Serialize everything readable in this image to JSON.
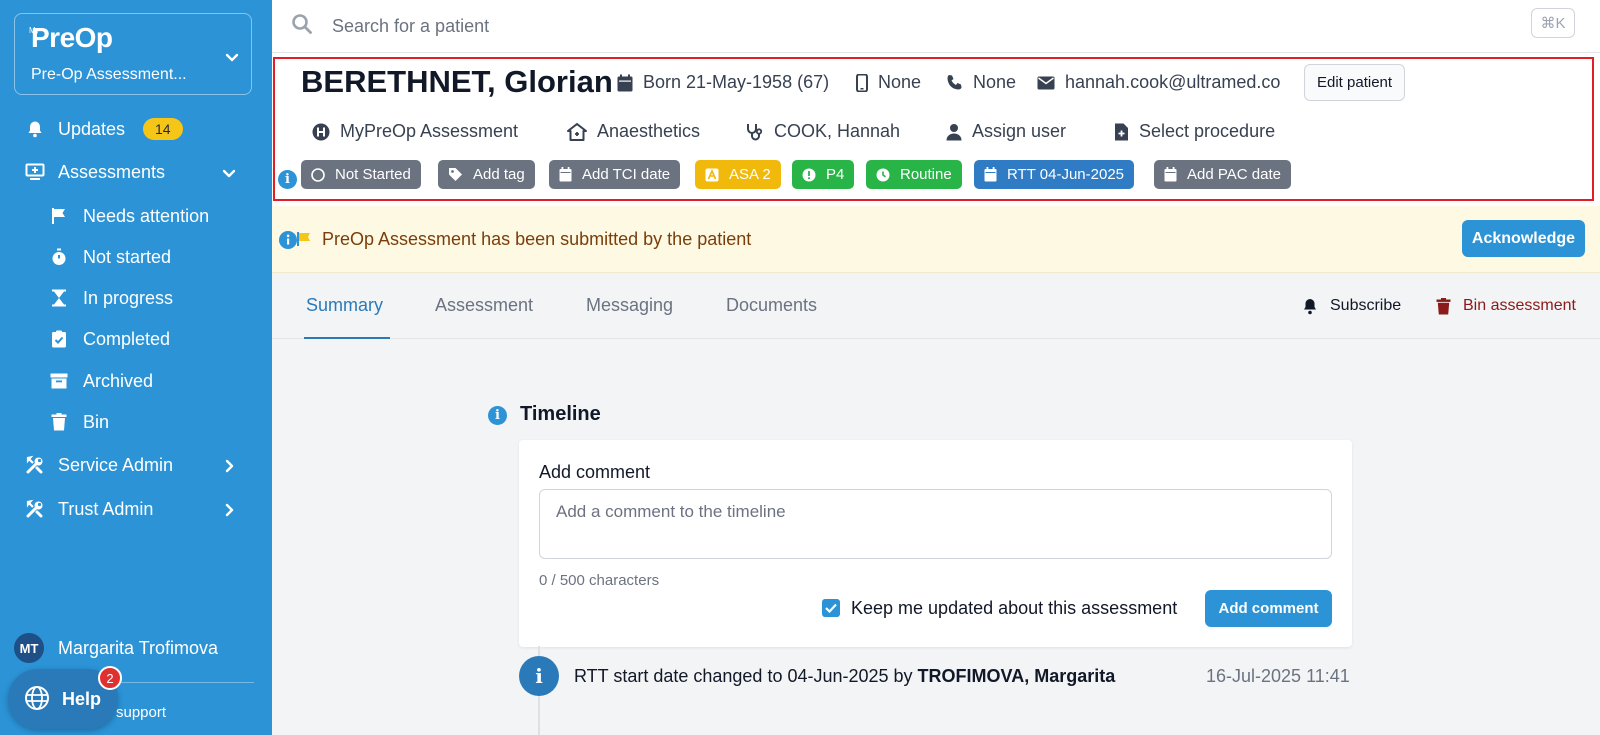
{
  "sidebar": {
    "logo_small": "My",
    "logo": "PreOp",
    "org_name": "Pre-Op Assessment...",
    "updates_label": "Updates",
    "updates_count": "14",
    "assessments_label": "Assessments",
    "sub_items": [
      "Needs attention",
      "Not started",
      "In progress",
      "Completed",
      "Archived",
      "Bin"
    ],
    "service_admin": "Service Admin",
    "trust_admin": "Trust Admin",
    "user_initials": "MT",
    "user_name": "Margarita Trofimova",
    "support_label": "support",
    "help_label": "Help",
    "help_count": "2"
  },
  "search": {
    "placeholder": "Search for a patient",
    "shortcut": "⌘K"
  },
  "patient": {
    "name": "BERETHNET, Glorian",
    "born": "Born 21-May-1958 (67)",
    "mobile": "None",
    "phone": "None",
    "email": "hannah.cook@ultramed.co",
    "edit_label": "Edit patient",
    "assessment_type": "MyPreOp Assessment",
    "specialty": "Anaesthetics",
    "clinician": "COOK, Hannah",
    "assign_user": "Assign user",
    "select_procedure": "Select procedure",
    "chips": {
      "status": "Not Started",
      "tag": "Add tag",
      "tci": "Add TCI date",
      "asa": "ASA 2",
      "priority": "P4",
      "urgency": "Routine",
      "rtt": "RTT 04-Jun-2025",
      "pac": "Add PAC date"
    }
  },
  "banner": {
    "text": "PreOp Assessment has been submitted by the patient",
    "button": "Acknowledge"
  },
  "tabs": [
    "Summary",
    "Assessment",
    "Messaging",
    "Documents"
  ],
  "actions": {
    "subscribe": "Subscribe",
    "bin": "Bin assessment"
  },
  "timeline": {
    "title": "Timeline",
    "comment_label": "Add comment",
    "comment_placeholder": "Add a comment to the timeline",
    "char_count": "0 / 500 characters",
    "keep_updated": "Keep me updated about this assessment",
    "add_button": "Add comment",
    "event_text": "RTT start date changed to 04-Jun-2025 by ",
    "event_author": "TROFIMOVA, Margarita",
    "event_time": "16-Jul-2025 11:41"
  },
  "colors": {
    "sidebar": "#2b93d6",
    "accent": "#2a7ab9",
    "highlight": "#e11d26",
    "asa_chip": "#f0b90b",
    "green_chip": "#28b446",
    "rtt_chip": "#2f7bc4",
    "bin_action": "#8b1a1a"
  }
}
